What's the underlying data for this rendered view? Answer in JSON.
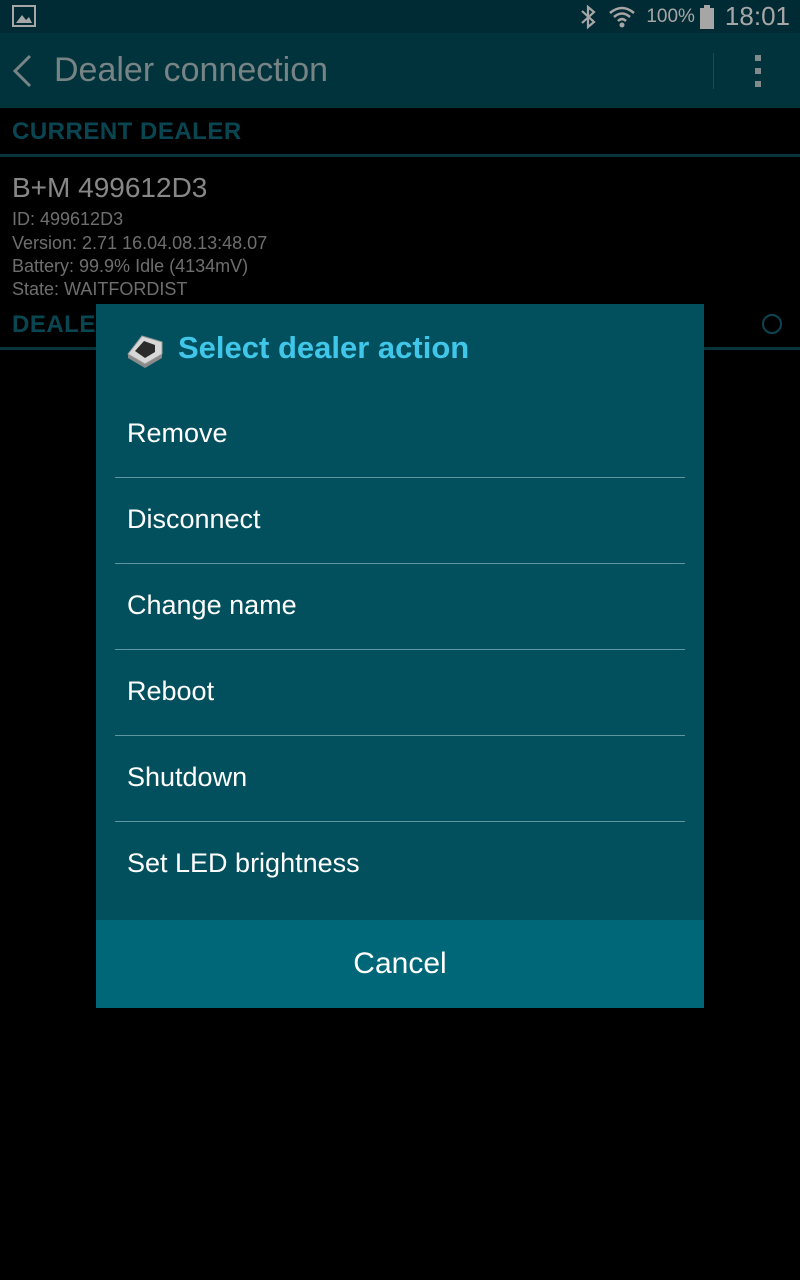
{
  "status_bar": {
    "battery_percent": "100%",
    "time": "18:01",
    "icons": [
      "gallery-icon",
      "bluetooth-icon",
      "wifi-icon",
      "battery-icon"
    ]
  },
  "action_bar": {
    "title": "Dealer connection",
    "icons": [
      "back-icon",
      "overflow-menu-icon"
    ]
  },
  "content": {
    "current_dealer_header": "CURRENT DEALER",
    "dealer_name": "B+M 499612D3",
    "dealer_id": "ID: 499612D3",
    "dealer_version": "Version: 2.71 16.04.08.13:48.07",
    "dealer_battery": "Battery: 99.9% Idle (4134mV)",
    "dealer_state": "State: WAITFORDIST",
    "dealers_header_visible": "DEALE"
  },
  "dialog": {
    "title": "Select dealer action",
    "icon": "dealer-device-icon",
    "items": [
      "Remove",
      "Disconnect",
      "Change name",
      "Reboot",
      "Shutdown",
      "Set LED brightness"
    ],
    "cancel_label": "Cancel"
  },
  "colors": {
    "statusbar_bg": "#004150",
    "actionbar_bg": "#004f5d",
    "dialog_bg": "#02505e",
    "accent_title": "#3fc6e8",
    "cancel_bg": "#006778",
    "section_header_text": "#0f6c7e"
  }
}
